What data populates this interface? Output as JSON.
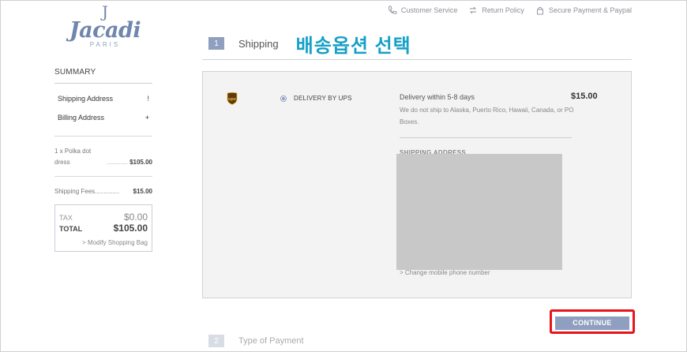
{
  "brand": {
    "crown": "J",
    "name": "Jacadi",
    "sub": "PARIS"
  },
  "top_links": [
    {
      "label": "Customer Service",
      "icon": "phone-icon"
    },
    {
      "label": "Return Policy",
      "icon": "return-icon"
    },
    {
      "label": "Secure Payment & Paypal",
      "icon": "lock-icon"
    }
  ],
  "step1": {
    "number": "1",
    "label": "Shipping",
    "note": "배송옵션 선택"
  },
  "summary": {
    "title": "SUMMARY",
    "shipping_address": "Shipping Address",
    "shipping_address_toggle": "!",
    "billing_address": "Billing Address",
    "billing_address_toggle": "+",
    "item_qty_name": "1 x Polka dot",
    "item_name_cont": "dress",
    "item_dots": "............",
    "item_price": "$105.00",
    "fees_label": "Shipping Fees",
    "fees_dots": "..............",
    "fees_value": "$15.00",
    "tax_label": "TAX",
    "tax_value": "$0.00",
    "total_label": "TOTAL",
    "total_value": "$105.00",
    "modify_link": "> Modify Shopping Bag"
  },
  "delivery": {
    "method_label": "DELIVERY BY UPS",
    "time": "Delivery within 5-8 days",
    "price": "$15.00",
    "description": "We do not ship to Alaska, Puerto Rico, Hawaii, Canada, or PO Boxes.",
    "shipping_address_label": "SHIPPING ADDRESS",
    "change_phone": "> Change mobile phone number"
  },
  "continue_label": "CONTINUE",
  "step2": {
    "number": "2",
    "label": "Type of Payment"
  },
  "colors": {
    "accent": "#8e9fbf",
    "logo": "#6f87ad",
    "note": "#15a0c8",
    "highlight": "#e8141c"
  }
}
